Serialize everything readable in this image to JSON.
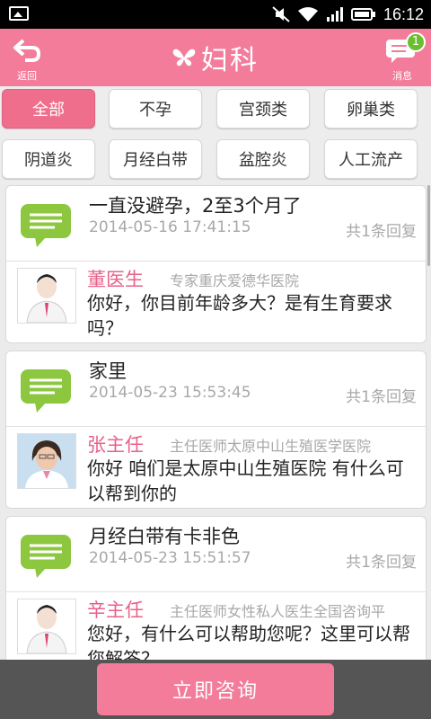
{
  "status_bar": {
    "time": "16:12"
  },
  "header": {
    "back_label": "返回",
    "title": "妇科",
    "messages_label": "消息",
    "messages_badge": "1"
  },
  "categories": [
    "全部",
    "不孕",
    "宫颈类",
    "卵巢类",
    "阴道炎",
    "月经白带",
    "盆腔炎",
    "人工流产"
  ],
  "selected_category": "全部",
  "questions": [
    {
      "title": "一直没避孕，2至3个月了",
      "date": "2014-05-16 17:41:15",
      "reply_count": "共1条回复",
      "doctor_name": "董医生",
      "doctor_title": "专家重庆爱德华医院",
      "reply": "你好，你目前年龄多大？是有生育要求吗？"
    },
    {
      "title": "家里",
      "date": "2014-05-23 15:53:45",
      "reply_count": "共1条回复",
      "doctor_name": "张主任",
      "doctor_title": "主任医师太原中山生殖医学医院",
      "reply": "你好 咱们是太原中山生殖医院 有什么可以帮到你的"
    },
    {
      "title": "月经白带有卡非色",
      "date": "2014-05-23 15:51:57",
      "reply_count": "共1条回复",
      "doctor_name": "辛主任",
      "doctor_title": "主任医师女性私人医生全国咨询平",
      "reply": "您好，有什么可以帮助您呢？这里可以帮您解答？"
    }
  ],
  "bottom": {
    "consult_label": "立即咨询"
  },
  "colors": {
    "accent": "#f27c99",
    "doctor_name": "#e8618a",
    "bubble_green": "#8dc63f"
  }
}
